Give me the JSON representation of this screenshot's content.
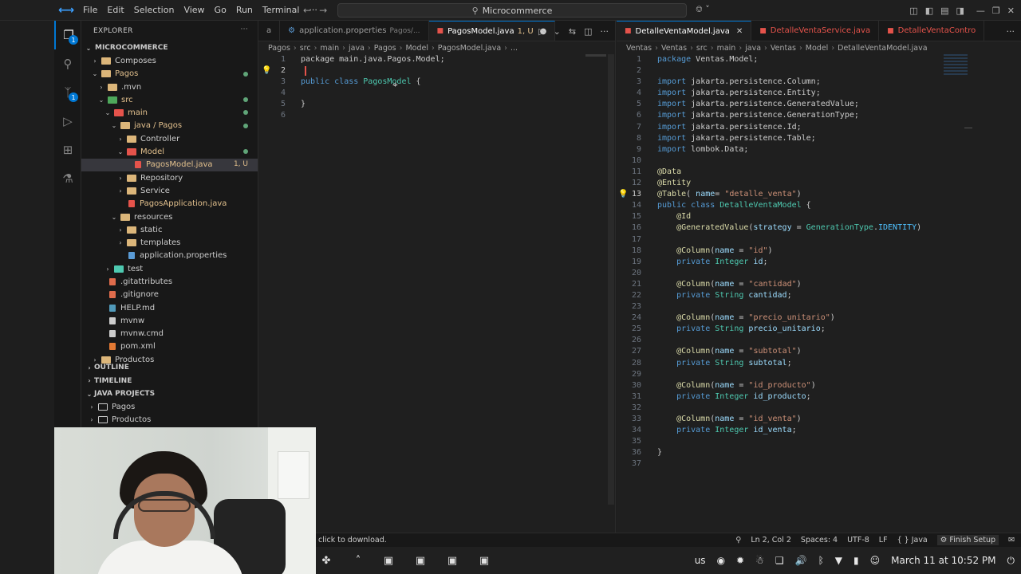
{
  "titlebar": {
    "menu": [
      "File",
      "Edit",
      "Selection",
      "View",
      "Go",
      "Run",
      "Terminal",
      "···"
    ],
    "search": "Microcommerce"
  },
  "sidebar": {
    "title": "EXPLORER",
    "root": "MICROCOMMERCE",
    "tree": [
      {
        "label": "Composes",
        "indent": 1,
        "chev": "›",
        "kind": "folder"
      },
      {
        "label": "Pagos",
        "indent": 1,
        "chev": "⌄",
        "kind": "folder",
        "dot": true
      },
      {
        "label": ".mvn",
        "indent": 2,
        "chev": "›",
        "kind": "folder"
      },
      {
        "label": "src",
        "indent": 2,
        "chev": "⌄",
        "kind": "folder-src",
        "dot": true
      },
      {
        "label": "main",
        "indent": 3,
        "chev": "⌄",
        "kind": "folder-red",
        "dot": true
      },
      {
        "label": "java / Pagos",
        "indent": 4,
        "chev": "⌄",
        "kind": "folder",
        "dot": true
      },
      {
        "label": "Controller",
        "indent": 5,
        "chev": "›",
        "kind": "folder"
      },
      {
        "label": "Model",
        "indent": 5,
        "chev": "⌄",
        "kind": "folder-red",
        "dot": true
      },
      {
        "label": "PagosModel.java",
        "indent": 6,
        "chev": "",
        "kind": "java",
        "selected": true,
        "badge": "1, U"
      },
      {
        "label": "Repository",
        "indent": 5,
        "chev": "›",
        "kind": "folder"
      },
      {
        "label": "Service",
        "indent": 5,
        "chev": "›",
        "kind": "folder"
      },
      {
        "label": "PagosApplication.java",
        "indent": 5,
        "chev": "",
        "kind": "java"
      },
      {
        "label": "resources",
        "indent": 4,
        "chev": "⌄",
        "kind": "folder"
      },
      {
        "label": "static",
        "indent": 5,
        "chev": "›",
        "kind": "folder"
      },
      {
        "label": "templates",
        "indent": 5,
        "chev": "›",
        "kind": "folder"
      },
      {
        "label": "application.properties",
        "indent": 5,
        "chev": "",
        "kind": "gear"
      },
      {
        "label": "test",
        "indent": 3,
        "chev": "›",
        "kind": "folder-test"
      },
      {
        "label": ".gitattributes",
        "indent": 2,
        "chev": "",
        "kind": "git"
      },
      {
        "label": ".gitignore",
        "indent": 2,
        "chev": "",
        "kind": "git"
      },
      {
        "label": "HELP.md",
        "indent": 2,
        "chev": "",
        "kind": "md"
      },
      {
        "label": "mvnw",
        "indent": 2,
        "chev": "",
        "kind": "file"
      },
      {
        "label": "mvnw.cmd",
        "indent": 2,
        "chev": "",
        "kind": "file"
      },
      {
        "label": "pom.xml",
        "indent": 2,
        "chev": "",
        "kind": "xml"
      },
      {
        "label": "Productos",
        "indent": 1,
        "chev": "›",
        "kind": "folder"
      }
    ],
    "outline": "OUTLINE",
    "timeline": "TIMELINE",
    "java_projects": "JAVA PROJECTS",
    "projects": [
      "Pagos",
      "Productos"
    ]
  },
  "left_editor": {
    "tabs": [
      {
        "label": "a",
        "kind": "cut"
      },
      {
        "label": "application.properties",
        "sub": "Pagos/...",
        "kind": "gear"
      },
      {
        "label": "PagosModel.java",
        "sub": "1, U",
        "kind": "java",
        "active": true,
        "dirty": "●"
      }
    ],
    "breadcrumb": [
      "Pagos",
      "src",
      "main",
      "java",
      "Pagos",
      "Model",
      "PagosModel.java",
      "..."
    ],
    "lines": [
      [
        {
          "t": "package main.java.Pagos.Model;",
          "c": "pk"
        }
      ],
      [],
      [
        {
          "t": "public ",
          "c": "kw"
        },
        {
          "t": "class ",
          "c": "kw"
        },
        {
          "t": "PagosModel",
          "c": "ty"
        },
        {
          "t": " {",
          "c": "pk"
        }
      ],
      [],
      [
        {
          "t": "}",
          "c": "pk"
        }
      ],
      []
    ]
  },
  "right_editor": {
    "tabs": [
      {
        "label": "DetalleVentaModel.java",
        "kind": "java",
        "active": true
      },
      {
        "label": "DetalleVentaService.java",
        "kind": "java"
      },
      {
        "label": "DetalleVentaContro",
        "kind": "java"
      }
    ],
    "breadcrumb": [
      "Ventas",
      "Ventas",
      "src",
      "main",
      "java",
      "Ventas",
      "Model",
      "DetalleVentaModel.java"
    ],
    "lines": [
      [
        {
          "t": "package ",
          "c": "kw"
        },
        {
          "t": "Ventas.Model;",
          "c": "pk"
        }
      ],
      [],
      [
        {
          "t": "import ",
          "c": "kw"
        },
        {
          "t": "jakarta.persistence.Column;",
          "c": "pk"
        }
      ],
      [
        {
          "t": "import ",
          "c": "kw"
        },
        {
          "t": "jakarta.persistence.Entity;",
          "c": "pk"
        }
      ],
      [
        {
          "t": "import ",
          "c": "kw"
        },
        {
          "t": "jakarta.persistence.GeneratedValue;",
          "c": "pk"
        }
      ],
      [
        {
          "t": "import ",
          "c": "kw"
        },
        {
          "t": "jakarta.persistence.GenerationType;",
          "c": "pk"
        }
      ],
      [
        {
          "t": "import ",
          "c": "kw"
        },
        {
          "t": "jakarta.persistence.Id;",
          "c": "pk"
        }
      ],
      [
        {
          "t": "import ",
          "c": "kw"
        },
        {
          "t": "jakarta.persistence.Table;",
          "c": "pk"
        }
      ],
      [
        {
          "t": "import ",
          "c": "kw"
        },
        {
          "t": "lombok.Data;",
          "c": "pk"
        }
      ],
      [],
      [
        {
          "t": "@Data",
          "c": "an"
        }
      ],
      [
        {
          "t": "@Entity",
          "c": "an"
        }
      ],
      [
        {
          "t": "@Table",
          "c": "an"
        },
        {
          "t": "( ",
          "c": "pk"
        },
        {
          "t": "name",
          "c": "vr"
        },
        {
          "t": "= ",
          "c": "pk"
        },
        {
          "t": "\"detalle_venta\"",
          "c": "st"
        },
        {
          "t": ")",
          "c": "pk"
        }
      ],
      [
        {
          "t": "public ",
          "c": "kw"
        },
        {
          "t": "class ",
          "c": "kw"
        },
        {
          "t": "DetalleVentaModel",
          "c": "ty"
        },
        {
          "t": " {",
          "c": "pk"
        }
      ],
      [
        {
          "t": "    @Id",
          "c": "an"
        }
      ],
      [
        {
          "t": "    @GeneratedValue",
          "c": "an"
        },
        {
          "t": "(",
          "c": "pk"
        },
        {
          "t": "strategy",
          "c": "vr"
        },
        {
          "t": " = ",
          "c": "pk"
        },
        {
          "t": "GenerationType",
          "c": "ty"
        },
        {
          "t": ".",
          "c": "pk"
        },
        {
          "t": "IDENTITY",
          "c": "cl"
        },
        {
          "t": ")",
          "c": "pk"
        }
      ],
      [],
      [
        {
          "t": "    @Column",
          "c": "an"
        },
        {
          "t": "(",
          "c": "pk"
        },
        {
          "t": "name",
          "c": "vr"
        },
        {
          "t": " = ",
          "c": "pk"
        },
        {
          "t": "\"id\"",
          "c": "st"
        },
        {
          "t": ")",
          "c": "pk"
        }
      ],
      [
        {
          "t": "    private ",
          "c": "kw"
        },
        {
          "t": "Integer ",
          "c": "ty"
        },
        {
          "t": "id",
          "c": "vr"
        },
        {
          "t": ";",
          "c": "pk"
        }
      ],
      [],
      [
        {
          "t": "    @Column",
          "c": "an"
        },
        {
          "t": "(",
          "c": "pk"
        },
        {
          "t": "name",
          "c": "vr"
        },
        {
          "t": " = ",
          "c": "pk"
        },
        {
          "t": "\"cantidad\"",
          "c": "st"
        },
        {
          "t": ")",
          "c": "pk"
        }
      ],
      [
        {
          "t": "    private ",
          "c": "kw"
        },
        {
          "t": "String ",
          "c": "ty"
        },
        {
          "t": "cantidad",
          "c": "vr"
        },
        {
          "t": ";",
          "c": "pk"
        }
      ],
      [],
      [
        {
          "t": "    @Column",
          "c": "an"
        },
        {
          "t": "(",
          "c": "pk"
        },
        {
          "t": "name",
          "c": "vr"
        },
        {
          "t": " = ",
          "c": "pk"
        },
        {
          "t": "\"precio_unitario\"",
          "c": "st"
        },
        {
          "t": ")",
          "c": "pk"
        }
      ],
      [
        {
          "t": "    private ",
          "c": "kw"
        },
        {
          "t": "String ",
          "c": "ty"
        },
        {
          "t": "precio_unitario",
          "c": "vr"
        },
        {
          "t": ";",
          "c": "pk"
        }
      ],
      [],
      [
        {
          "t": "    @Column",
          "c": "an"
        },
        {
          "t": "(",
          "c": "pk"
        },
        {
          "t": "name",
          "c": "vr"
        },
        {
          "t": " = ",
          "c": "pk"
        },
        {
          "t": "\"subtotal\"",
          "c": "st"
        },
        {
          "t": ")",
          "c": "pk"
        }
      ],
      [
        {
          "t": "    private ",
          "c": "kw"
        },
        {
          "t": "String ",
          "c": "ty"
        },
        {
          "t": "subtotal",
          "c": "vr"
        },
        {
          "t": ";",
          "c": "pk"
        }
      ],
      [],
      [
        {
          "t": "    @Column",
          "c": "an"
        },
        {
          "t": "(",
          "c": "pk"
        },
        {
          "t": "name",
          "c": "vr"
        },
        {
          "t": " = ",
          "c": "pk"
        },
        {
          "t": "\"id_producto\"",
          "c": "st"
        },
        {
          "t": ")",
          "c": "pk"
        }
      ],
      [
        {
          "t": "    private ",
          "c": "kw"
        },
        {
          "t": "Integer ",
          "c": "ty"
        },
        {
          "t": "id_producto",
          "c": "vr"
        },
        {
          "t": ";",
          "c": "pk"
        }
      ],
      [],
      [
        {
          "t": "    @Column",
          "c": "an"
        },
        {
          "t": "(",
          "c": "pk"
        },
        {
          "t": "name",
          "c": "vr"
        },
        {
          "t": " = ",
          "c": "pk"
        },
        {
          "t": "\"id_venta\"",
          "c": "st"
        },
        {
          "t": ")",
          "c": "pk"
        }
      ],
      [
        {
          "t": "    private ",
          "c": "kw"
        },
        {
          "t": "Integer ",
          "c": "ty"
        },
        {
          "t": "id_venta",
          "c": "vr"
        },
        {
          "t": ";",
          "c": "pk"
        }
      ],
      [],
      [
        {
          "t": "}",
          "c": "pk"
        }
      ],
      []
    ]
  },
  "statusbar": {
    "hint": "click to download.",
    "position": "Ln 2, Col 2",
    "spaces": "Spaces: 4",
    "encoding": "UTF-8",
    "eol": "LF",
    "language": "{ } Java",
    "finish_setup": "Finish Setup"
  },
  "taskbar": {
    "keyboard": "us",
    "datetime": "March 11 at 10:52 PM"
  },
  "colors": {
    "accent": "#0078d4",
    "keyword": "#569cd6",
    "type": "#4ec9b0",
    "annotation": "#dcdcaa",
    "string": "#ce9178"
  }
}
